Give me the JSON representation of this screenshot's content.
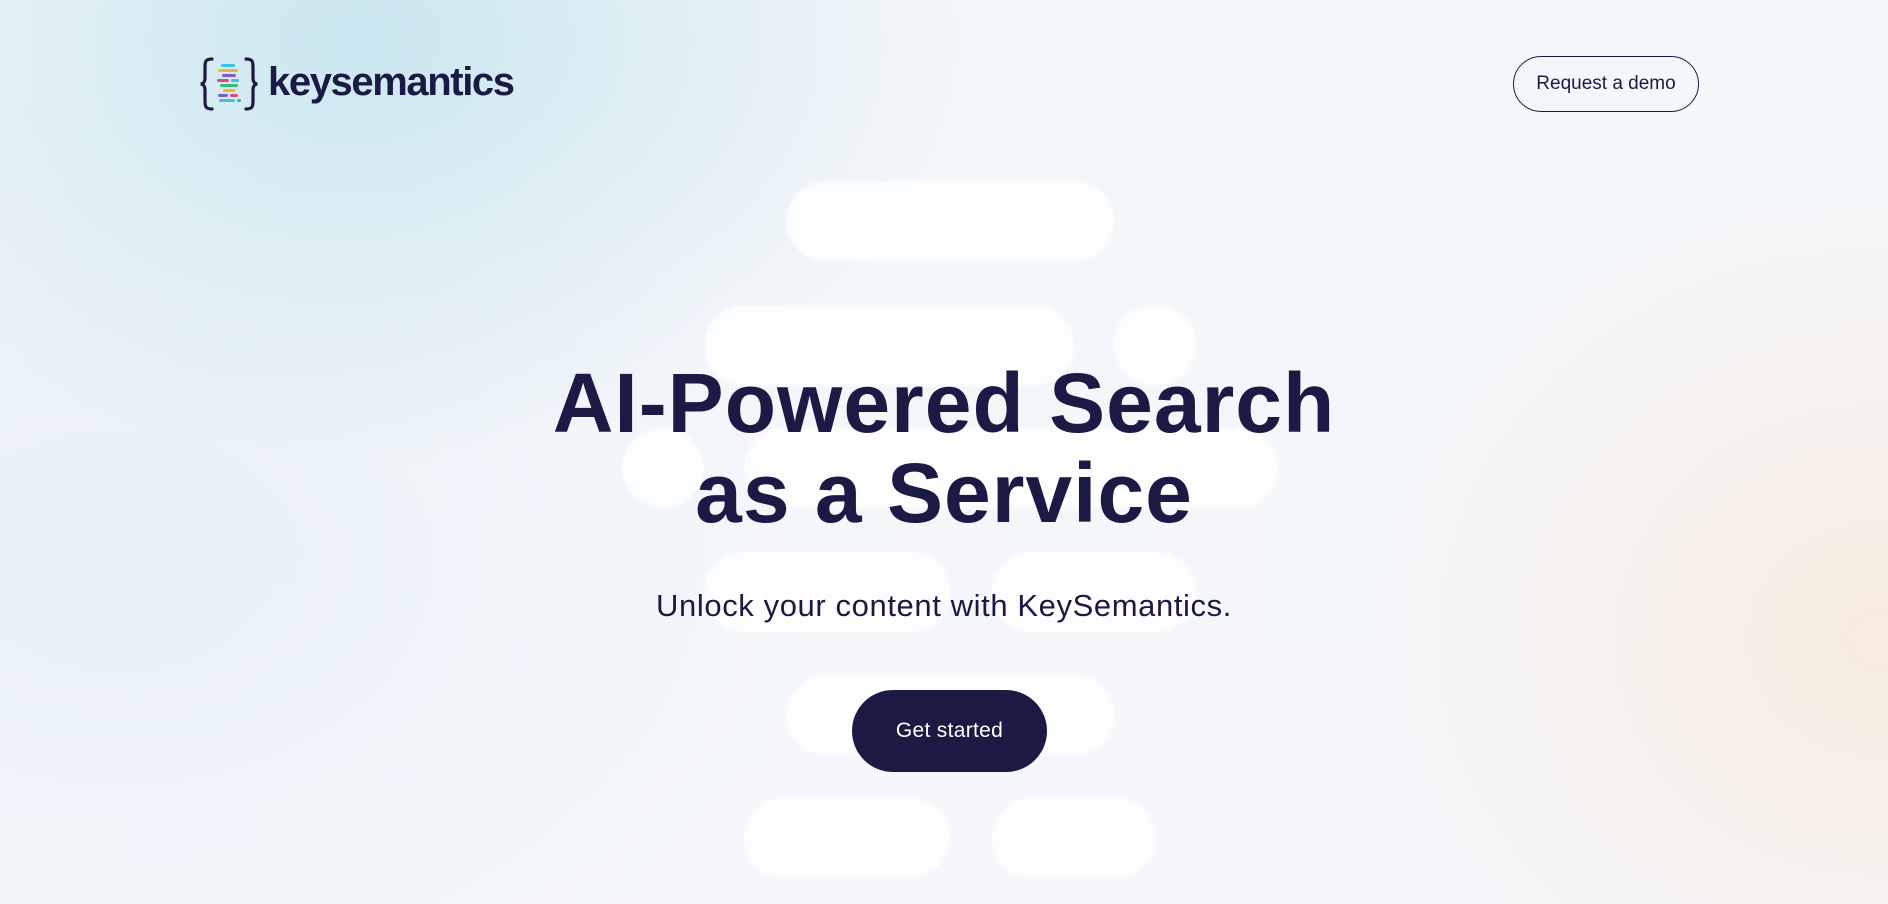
{
  "header": {
    "logo_text": "keysemantics",
    "demo_button_label": "Request a demo"
  },
  "hero": {
    "title_line1": "AI-Powered Search",
    "title_line2": "as a Service",
    "subtitle": "Unlock your content with KeySemantics.",
    "cta_label": "Get started"
  },
  "colors": {
    "brand_navy": "#1b1a45",
    "cta_text": "#ffffff",
    "logo_bracket": "#1b1a45",
    "logo_bars": [
      "#3cc4e0",
      "#f2b233",
      "#e8457a",
      "#7a5cd6",
      "#3fb87a"
    ]
  },
  "icons": {
    "logo": "keysemantics-braces-logo-icon"
  }
}
